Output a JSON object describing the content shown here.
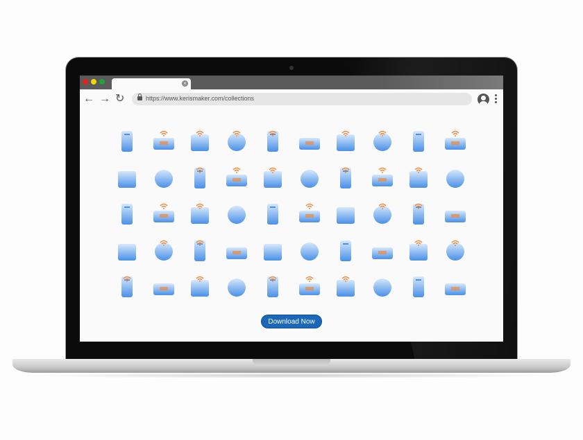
{
  "browser": {
    "url": "https://www.kerismaker.com/collections",
    "traffic_lights": [
      "#e0201b",
      "#f1d900",
      "#1fa23a"
    ],
    "tab_close": "×",
    "back": "←",
    "forward": "→",
    "reload": "↻"
  },
  "colors": {
    "icon_blue": "#4a90e8",
    "icon_light": "#d6e8fb",
    "wifi_orange": "#f08a3c",
    "button": "#1b67b8"
  },
  "icons": [
    {
      "name": "globe",
      "wifi": false
    },
    {
      "name": "server-network",
      "wifi": true
    },
    {
      "name": "router",
      "wifi": true
    },
    {
      "name": "smart-car",
      "wifi": true
    },
    {
      "name": "smartphone-wifi",
      "wifi": true
    },
    {
      "name": "remote-control",
      "wifi": false
    },
    {
      "name": "smart-bulb",
      "wifi": true
    },
    {
      "name": "signal-tower",
      "wifi": true
    },
    {
      "name": "gauge",
      "wifi": false
    },
    {
      "name": "cloud-network",
      "wifi": true
    },
    {
      "name": "security-camera",
      "wifi": false
    },
    {
      "name": "air-conditioner",
      "wifi": false
    },
    {
      "name": "vr-headset",
      "wifi": true
    },
    {
      "name": "smart-lock",
      "wifi": true
    },
    {
      "name": "drone",
      "wifi": true
    },
    {
      "name": "smart-door",
      "wifi": false
    },
    {
      "name": "monitor-wifi",
      "wifi": true
    },
    {
      "name": "shopping-cart",
      "wifi": true
    },
    {
      "name": "delivery-drone",
      "wifi": true
    },
    {
      "name": "nfc-card",
      "wifi": false
    },
    {
      "name": "microchip",
      "wifi": false
    },
    {
      "name": "camera",
      "wifi": true
    },
    {
      "name": "location-pin",
      "wifi": true
    },
    {
      "name": "credit-cards",
      "wifi": false
    },
    {
      "name": "solar-panel",
      "wifi": false
    },
    {
      "name": "power-socket",
      "wifi": true
    },
    {
      "name": "phone-scanner",
      "wifi": false
    },
    {
      "name": "door-handle",
      "wifi": true
    },
    {
      "name": "car-thermometer",
      "wifi": true
    },
    {
      "name": "smartwatch",
      "wifi": false
    },
    {
      "name": "radiator",
      "wifi": false
    },
    {
      "name": "printer",
      "wifi": true
    },
    {
      "name": "headphones",
      "wifi": true
    },
    {
      "name": "safe",
      "wifi": false
    },
    {
      "name": "game-controller",
      "wifi": false
    },
    {
      "name": "smart-home",
      "wifi": false
    },
    {
      "name": "e-reader",
      "wifi": false
    },
    {
      "name": "game-remotes",
      "wifi": false
    },
    {
      "name": "desktop-computer",
      "wifi": true
    },
    {
      "name": "smart-faucet",
      "wifi": true
    },
    {
      "name": "smart-greenhouse",
      "wifi": true
    },
    {
      "name": "medical-monitor",
      "wifi": false
    },
    {
      "name": "refrigerator",
      "wifi": true
    },
    {
      "name": "washing-machine",
      "wifi": false
    },
    {
      "name": "smart-wallet",
      "wifi": true
    },
    {
      "name": "computer-mouse",
      "wifi": true
    },
    {
      "name": "smart-tv-stand",
      "wifi": true
    },
    {
      "name": "coffee-machine",
      "wifi": false
    },
    {
      "name": "robot-arm",
      "wifi": false
    },
    {
      "name": "thermometer",
      "wifi": false
    }
  ],
  "main": {
    "download_label": "Download Now"
  }
}
